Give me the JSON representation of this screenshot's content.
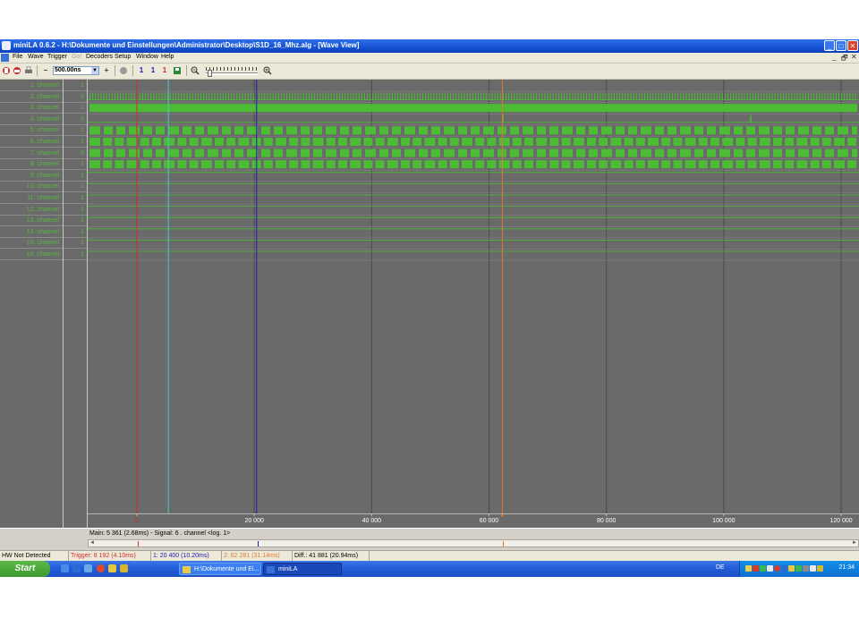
{
  "window": {
    "title": "miniLA 0.6.2 - H:\\Dokumente und Einstellungen\\Administrator\\Desktop\\S1D_16_Mhz.alg - [Wave View]",
    "minimize": "_",
    "maximize": "□",
    "close": "✕"
  },
  "menu": {
    "items": [
      {
        "label": "File",
        "enabled": true
      },
      {
        "label": "Wave",
        "enabled": true
      },
      {
        "label": "Trigger",
        "enabled": true
      },
      {
        "label": "Go!",
        "enabled": false
      },
      {
        "label": "Decoders",
        "enabled": true
      },
      {
        "label": "Setup",
        "enabled": true
      },
      {
        "label": "Window",
        "enabled": true
      },
      {
        "label": "Help",
        "enabled": true
      }
    ],
    "mdi_controls": [
      "_",
      "🗗",
      "✕"
    ]
  },
  "toolbar": {
    "zoom_value": "500.00ns",
    "minus": "−",
    "plus": "+",
    "cursor_labels": [
      "1",
      "1",
      "1"
    ]
  },
  "channels": [
    {
      "name": "1. channel",
      "value": "1"
    },
    {
      "name": "2. channel",
      "value": "0"
    },
    {
      "name": "3. channel",
      "value": "1"
    },
    {
      "name": "4. channel",
      "value": "0"
    },
    {
      "name": "5. channel",
      "value": "1"
    },
    {
      "name": "6. channel",
      "value": "1"
    },
    {
      "name": "7. channel",
      "value": "0"
    },
    {
      "name": "8. channel",
      "value": "1"
    },
    {
      "name": "9. channel",
      "value": "1"
    },
    {
      "name": "10. channel",
      "value": "1"
    },
    {
      "name": "11. channel",
      "value": "1"
    },
    {
      "name": "12. channel",
      "value": "1"
    },
    {
      "name": "13. channel",
      "value": "1"
    },
    {
      "name": "14. channel",
      "value": "1"
    },
    {
      "name": "15. channel",
      "value": "1"
    },
    {
      "name": "16. channel",
      "value": "1"
    }
  ],
  "axis": {
    "min": 0,
    "max": 122000,
    "ticks": [
      {
        "value": 0,
        "label": "0"
      },
      {
        "value": 20000,
        "label": "20 000"
      },
      {
        "value": 40000,
        "label": "40 000"
      },
      {
        "value": 60000,
        "label": "60 000"
      },
      {
        "value": 80000,
        "label": "80 000"
      },
      {
        "value": 100000,
        "label": "100 000"
      },
      {
        "value": 120000,
        "label": "120 000"
      }
    ]
  },
  "cursors": {
    "trigger": {
      "sample": 0,
      "color": "#d42a2a"
    },
    "main": {
      "sample": 5361,
      "color": "#40d0c8"
    },
    "cursor1": {
      "sample": 20400,
      "color": "#1a1ab8"
    },
    "cursor2": {
      "sample": 62281,
      "color": "#e07a30"
    }
  },
  "colors": {
    "wave_bg": "#6a6a6a",
    "signal": "#4cbc34",
    "channel_text": "#58b83c"
  },
  "info_text": "Main: 5 361  (2.68ms) - Signal: 6 . channel <log. 1>",
  "status": [
    {
      "text": "HW Not Detected",
      "color": "#000000"
    },
    {
      "text": "Trigger: 8 192  (4.10ms)",
      "color": "#d42a2a"
    },
    {
      "text": "1: 20 400  (10.20ms)",
      "color": "#1a1ab8"
    },
    {
      "text": "2: 62 281  (31.14ms)",
      "color": "#e07a30"
    },
    {
      "text": "Diff.: 41 881  (20.94ms)",
      "color": "#000000"
    }
  ],
  "taskbar": {
    "start_label": "Start",
    "tasks": [
      {
        "label": "H:\\Dokumente und Ei..."
      },
      {
        "label": "miniLA"
      }
    ],
    "language": "DE",
    "clock": "21:34"
  }
}
